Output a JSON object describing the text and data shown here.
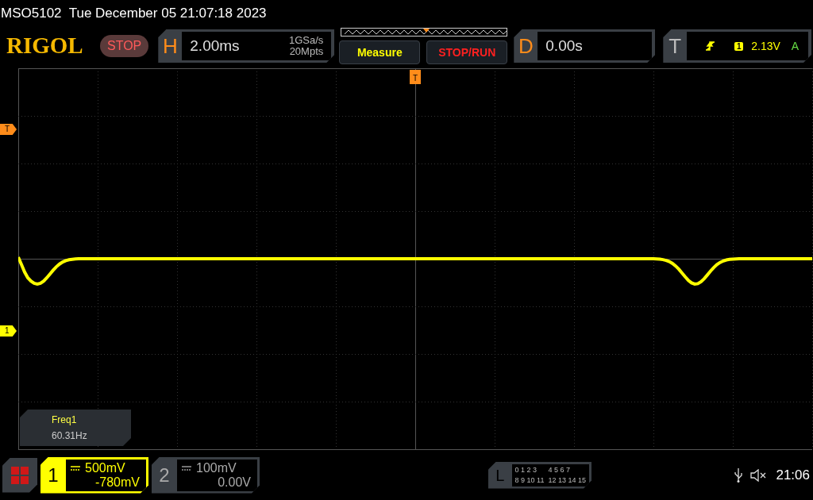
{
  "header": {
    "title": "MSO5102  Tue December 05 21:07:18 2023"
  },
  "toolbar": {
    "logo": "RIGOL",
    "run_state": "STOP",
    "horizontal": {
      "label": "H",
      "timebase": "2.00ms",
      "sample_rate": "1GSa/s",
      "memory_depth": "20Mpts"
    },
    "buttons": [
      {
        "label": "Measure",
        "color": "#ffff00"
      },
      {
        "label": "STOP/RUN",
        "color": "#ff2020"
      }
    ],
    "delay": {
      "label": "D",
      "value": "0.00s"
    },
    "trigger": {
      "label": "T",
      "source": "1",
      "level": "2.13V",
      "mode": "A"
    }
  },
  "screen": {
    "trigger_position_marker": "T",
    "trigger_level_marker": "T",
    "channel_marker": "1",
    "measurement": {
      "name": "Freq1",
      "value": "60.31Hz"
    }
  },
  "channels": [
    {
      "label": "1",
      "scale": "500mV",
      "offset": "-780mV",
      "on": true
    },
    {
      "label": "2",
      "scale": "100mV",
      "offset": "0.00V",
      "on": false
    }
  ],
  "logic": {
    "label": "L",
    "groups": [
      "0 1 2 3",
      "4 5 6 7",
      "8 9 10 11",
      "12 13 14 15"
    ]
  },
  "status_bar": {
    "time": "21:06"
  }
}
